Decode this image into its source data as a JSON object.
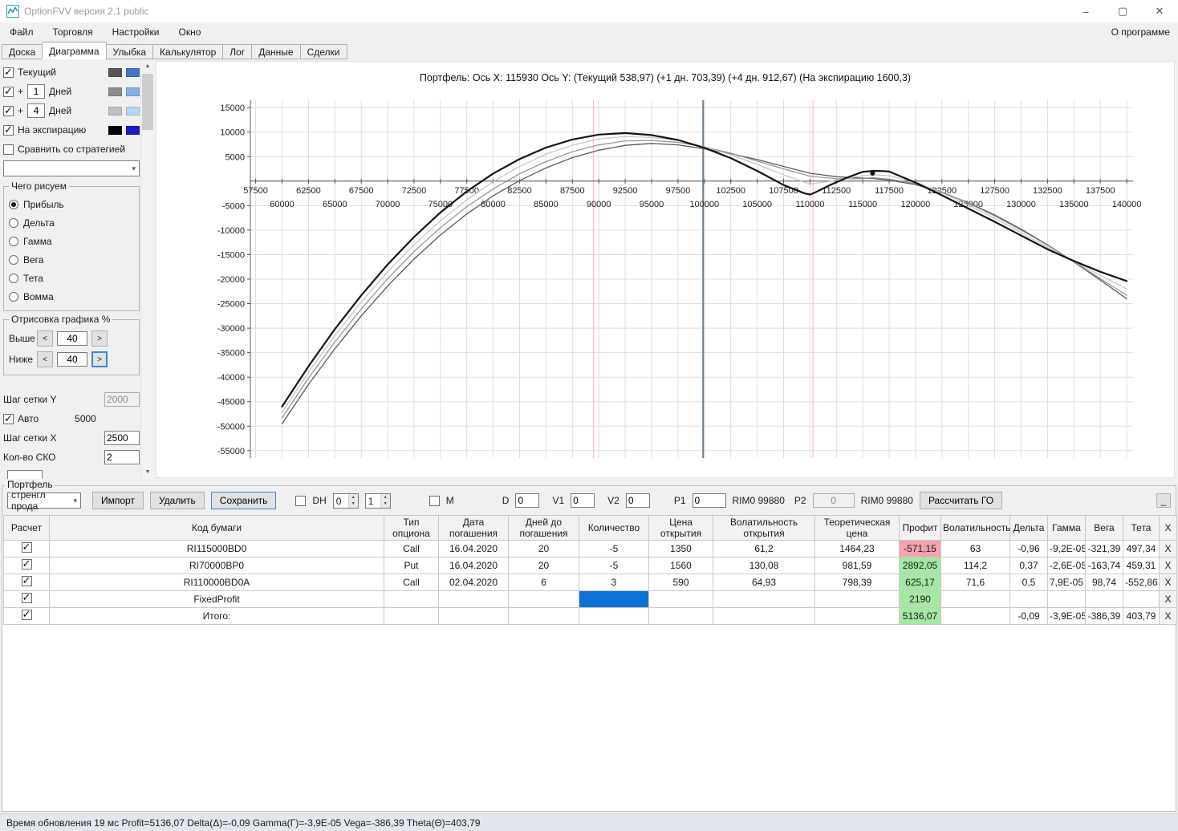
{
  "window": {
    "title": "OptionFVV версия 2.1 public",
    "controls": {
      "minimize": "–",
      "maximize": "▢",
      "close": "✕"
    }
  },
  "menu": {
    "items": [
      "Файл",
      "Торговля",
      "Настройки",
      "Окно"
    ],
    "right": "О программе"
  },
  "tabs": {
    "items": [
      "Доска",
      "Диаграмма",
      "Улыбка",
      "Калькулятор",
      "Лог",
      "Данные",
      "Сделки"
    ],
    "active": "Диаграмма"
  },
  "left_panel": {
    "legend": [
      {
        "label": "Текущий",
        "checked": true,
        "swatch1": "#555555",
        "swatch2": "#4472c4"
      },
      {
        "prefix": "+",
        "value": "1",
        "label": "Дней",
        "checked": true,
        "swatch1": "#8c8c8c",
        "swatch2": "#86b0e0"
      },
      {
        "prefix": "+",
        "value": "4",
        "label": "Дней",
        "checked": true,
        "swatch1": "#c0c0c0",
        "swatch2": "#b8d6f2"
      },
      {
        "label": "На экспирацию",
        "checked": true,
        "swatch1": "#000000",
        "swatch2": "#1a1acc"
      }
    ],
    "compare_label": "Сравнить со стратегией",
    "compare_checked": false,
    "strategy_value": "",
    "draw_group": {
      "title": "Чего рисуем",
      "options": [
        "Прибыль",
        "Дельта",
        "Гамма",
        "Вега",
        "Тета",
        "Вомма"
      ],
      "selected": "Прибыль"
    },
    "render_group": {
      "title": "Отрисовка графика %",
      "above_label": "Выше",
      "above_value": "40",
      "below_label": "Ниже",
      "below_value": "40",
      "less": "<",
      "more": ">"
    },
    "grid_y_label": "Шаг сетки Y",
    "grid_y_value": "2000",
    "auto_label": "Авто",
    "auto_checked": true,
    "auto_value": "5000",
    "grid_x_label": "Шаг сетки X",
    "grid_x_value": "2500",
    "sko_label": "Кол-во СКО",
    "sko_value": "2"
  },
  "chart_data": {
    "type": "line",
    "title": "Портфель:  Ось X: 115930  Ось Y:   (Текущий 538,97)  (+1 дн. 703,39)  (+4 дн. 912,67)  (На экспирацию 1600,3)",
    "x_range": [
      57000,
      140600
    ],
    "y_range": [
      -56500,
      16500
    ],
    "grid_step_x": 2500,
    "grid_step_y": 5000,
    "y_ticks": [
      15000,
      10000,
      5000,
      -5000,
      -10000,
      -15000,
      -20000,
      -25000,
      -30000,
      -35000,
      -40000,
      -45000,
      -50000,
      -55000
    ],
    "x_ticks_row1": [
      57500,
      62500,
      67500,
      72500,
      77500,
      82500,
      87500,
      92500,
      97500,
      102500,
      107500,
      112500,
      117500,
      122500,
      127500,
      132500,
      137500
    ],
    "x_ticks_row2": [
      60000,
      65000,
      70000,
      75000,
      80000,
      85000,
      90000,
      95000,
      100000,
      105000,
      110000,
      115000,
      120000,
      125000,
      130000,
      135000,
      140000
    ],
    "vlines": [
      {
        "name": "sko-low",
        "x": 89480,
        "color": "#f2b3c0",
        "width": 1
      },
      {
        "name": "sko-high",
        "x": 110280,
        "color": "#f2b3c0",
        "width": 1
      },
      {
        "name": "current-price",
        "x": 99880,
        "color": "#70828e",
        "width": 2
      }
    ],
    "marker": {
      "x": 115930,
      "y": 1600
    },
    "series": [
      {
        "name": "Текущий",
        "color": "#5a5a5a",
        "width": 1.3,
        "points": [
          [
            60000,
            -49500
          ],
          [
            62500,
            -41500
          ],
          [
            65000,
            -34200
          ],
          [
            67500,
            -27500
          ],
          [
            70000,
            -21400
          ],
          [
            72500,
            -15900
          ],
          [
            75000,
            -11000
          ],
          [
            77500,
            -6700
          ],
          [
            80000,
            -3000
          ],
          [
            82500,
            100
          ],
          [
            85000,
            2700
          ],
          [
            87500,
            4800
          ],
          [
            90000,
            6300
          ],
          [
            92500,
            7300
          ],
          [
            95000,
            7700
          ],
          [
            97500,
            7400
          ],
          [
            100000,
            6600
          ],
          [
            102500,
            5600
          ],
          [
            105000,
            4400
          ],
          [
            107500,
            3000
          ],
          [
            110000,
            1600
          ],
          [
            112500,
            900
          ],
          [
            115000,
            600
          ],
          [
            115930,
            540
          ],
          [
            117500,
            200
          ],
          [
            120000,
            -700
          ],
          [
            122500,
            -2300
          ],
          [
            125000,
            -4400
          ],
          [
            127500,
            -6900
          ],
          [
            130000,
            -9800
          ],
          [
            132500,
            -13000
          ],
          [
            135000,
            -16500
          ],
          [
            137500,
            -20200
          ],
          [
            140000,
            -24000
          ]
        ]
      },
      {
        "name": "+1 дн.",
        "color": "#909090",
        "width": 1.2,
        "points": [
          [
            60000,
            -48300
          ],
          [
            62500,
            -40200
          ],
          [
            65000,
            -32800
          ],
          [
            67500,
            -26100
          ],
          [
            70000,
            -19900
          ],
          [
            72500,
            -14400
          ],
          [
            75000,
            -9500
          ],
          [
            77500,
            -5200
          ],
          [
            80000,
            -1600
          ],
          [
            82500,
            1500
          ],
          [
            85000,
            4000
          ],
          [
            87500,
            6000
          ],
          [
            90000,
            7400
          ],
          [
            92500,
            8200
          ],
          [
            95000,
            8300
          ],
          [
            97500,
            7900
          ],
          [
            100000,
            7000
          ],
          [
            102500,
            5700
          ],
          [
            105000,
            4100
          ],
          [
            107500,
            2500
          ],
          [
            110000,
            1000
          ],
          [
            112500,
            500
          ],
          [
            115000,
            500
          ],
          [
            115930,
            700
          ],
          [
            117500,
            400
          ],
          [
            120000,
            -500
          ],
          [
            122500,
            -2200
          ],
          [
            125000,
            -4500
          ],
          [
            127500,
            -7100
          ],
          [
            130000,
            -10000
          ],
          [
            132500,
            -13100
          ],
          [
            135000,
            -16400
          ],
          [
            137500,
            -19900
          ],
          [
            140000,
            -23300
          ]
        ]
      },
      {
        "name": "+4 дн.",
        "color": "#c4c4c4",
        "width": 1.2,
        "points": [
          [
            60000,
            -47200
          ],
          [
            62500,
            -39000
          ],
          [
            65000,
            -31500
          ],
          [
            67500,
            -24700
          ],
          [
            70000,
            -18500
          ],
          [
            72500,
            -13000
          ],
          [
            75000,
            -8100
          ],
          [
            77500,
            -3800
          ],
          [
            80000,
            -100
          ],
          [
            82500,
            3000
          ],
          [
            85000,
            5500
          ],
          [
            87500,
            7300
          ],
          [
            90000,
            8600
          ],
          [
            92500,
            9100
          ],
          [
            95000,
            8900
          ],
          [
            97500,
            8300
          ],
          [
            100000,
            7000
          ],
          [
            102500,
            5400
          ],
          [
            105000,
            3400
          ],
          [
            107500,
            1300
          ],
          [
            110000,
            -600
          ],
          [
            112000,
            0
          ],
          [
            113500,
            600
          ],
          [
            115000,
            1100
          ],
          [
            116000,
            1300
          ],
          [
            117500,
            1100
          ],
          [
            120000,
            -200
          ],
          [
            122500,
            -2400
          ],
          [
            125000,
            -4900
          ],
          [
            127500,
            -7600
          ],
          [
            130000,
            -10500
          ],
          [
            132500,
            -13500
          ],
          [
            135000,
            -16400
          ],
          [
            137500,
            -19200
          ],
          [
            140000,
            -22000
          ]
        ]
      },
      {
        "name": "На экспирацию",
        "color": "#141414",
        "width": 2.2,
        "points": [
          [
            60000,
            -46000
          ],
          [
            62500,
            -37800
          ],
          [
            65000,
            -30200
          ],
          [
            67500,
            -23300
          ],
          [
            70000,
            -17000
          ],
          [
            72500,
            -11400
          ],
          [
            75000,
            -6400
          ],
          [
            77500,
            -2100
          ],
          [
            80000,
            1550
          ],
          [
            82500,
            4500
          ],
          [
            85000,
            6850
          ],
          [
            87500,
            8500
          ],
          [
            90000,
            9500
          ],
          [
            92500,
            9800
          ],
          [
            95000,
            9400
          ],
          [
            97500,
            8400
          ],
          [
            100000,
            6800
          ],
          [
            102500,
            4700
          ],
          [
            105000,
            2100
          ],
          [
            107500,
            -800
          ],
          [
            109500,
            -2500
          ],
          [
            110000,
            -2750
          ],
          [
            110500,
            -2300
          ],
          [
            112000,
            -700
          ],
          [
            113500,
            700
          ],
          [
            115000,
            1900
          ],
          [
            116000,
            2100
          ],
          [
            117000,
            2050
          ],
          [
            117500,
            1950
          ],
          [
            120000,
            -300
          ],
          [
            122500,
            -2900
          ],
          [
            125000,
            -5600
          ],
          [
            127500,
            -8300
          ],
          [
            130000,
            -11100
          ],
          [
            132500,
            -13900
          ],
          [
            135000,
            -16300
          ],
          [
            137500,
            -18500
          ],
          [
            140000,
            -20400
          ]
        ]
      }
    ]
  },
  "portfolio": {
    "section_label": "Портфель",
    "strategy_select": "стренгл прода",
    "buttons": {
      "import": "Импорт",
      "delete": "Удалить",
      "save": "Сохранить",
      "calc_go": "Рассчитать ГО"
    },
    "dh_label": "DH",
    "dh_checked": false,
    "dh1": "0",
    "dh2": "1",
    "m_label": "M",
    "m_checked": false,
    "d_label": "D",
    "d_value": "0",
    "v1_label": "V1",
    "v1_value": "0",
    "v2_label": "V2",
    "v2_value": "0",
    "p1_label": "P1",
    "p1_value": "0",
    "rim1": "RIM0 99880",
    "p2_label": "P2",
    "p2_value": "0",
    "rim2": "RIM0 99880",
    "minimize_label": "_"
  },
  "table": {
    "headers": [
      "Расчет",
      "Код бумаги",
      "Тип опциона",
      "Дата погашения",
      "Дней до погашения",
      "Количество",
      "Цена открытия",
      "Волатильность открытия",
      "Теоретическая цена",
      "Профит",
      "Волатильность",
      "Дельта",
      "Гамма",
      "Вега",
      "Тета",
      "X"
    ],
    "row_close": "X",
    "rows": [
      {
        "checked": true,
        "code": "RI115000BD0",
        "type": "Call",
        "expiry": "16.04.2020",
        "days": "20",
        "qty": "-5",
        "open_price": "1350",
        "open_vol": "61,2",
        "theor": "1464,23",
        "profit": "-571,15",
        "profit_state": "neg",
        "vol": "63",
        "delta": "-0,96",
        "gamma": "-9,2E-05",
        "vega": "-321,39",
        "theta": "497,34"
      },
      {
        "checked": true,
        "code": "RI70000BP0",
        "type": "Put",
        "expiry": "16.04.2020",
        "days": "20",
        "qty": "-5",
        "open_price": "1560",
        "open_vol": "130,08",
        "theor": "981,59",
        "profit": "2892,05",
        "profit_state": "pos",
        "vol": "114,2",
        "delta": "0,37",
        "gamma": "-2,6E-05",
        "vega": "-163,74",
        "theta": "459,31"
      },
      {
        "checked": true,
        "code": "RI110000BD0A",
        "type": "Call",
        "expiry": "02.04.2020",
        "days": "6",
        "qty": "3",
        "open_price": "590",
        "open_vol": "64,93",
        "theor": "798,39",
        "profit": "625,17",
        "profit_state": "pos",
        "vol": "71,6",
        "delta": "0,5",
        "gamma": "7,9E-05",
        "vega": "98,74",
        "theta": "-552,86"
      },
      {
        "checked": true,
        "code": "FixedProfit",
        "qty": "",
        "qty_selected": true,
        "profit": "2190",
        "profit_state": "pos"
      },
      {
        "checked": true,
        "code": "Итого:",
        "profit": "5136,07",
        "profit_state": "pos",
        "delta": "-0,09",
        "gamma": "-3,9E-05",
        "vega": "-386,39",
        "theta": "403,79"
      }
    ]
  },
  "status_bar": {
    "text": "Время обновления 19 мс   Profit=5136,07 Delta(Δ)=-0,09 Gamma(Γ)=-3,9E-05 Vega=-386,39 Theta(Θ)=403,79"
  }
}
